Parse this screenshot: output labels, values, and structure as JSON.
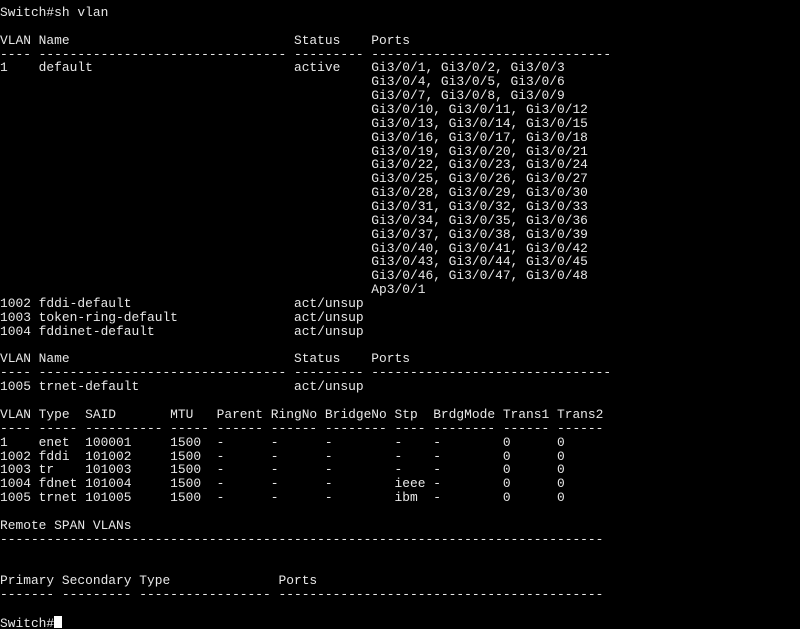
{
  "terminal": {
    "lines": [
      "Switch#sh vlan",
      "",
      "VLAN Name                             Status    Ports",
      "---- -------------------------------- --------- -------------------------------",
      "1    default                          active    Gi3/0/1, Gi3/0/2, Gi3/0/3",
      "                                                Gi3/0/4, Gi3/0/5, Gi3/0/6",
      "                                                Gi3/0/7, Gi3/0/8, Gi3/0/9",
      "                                                Gi3/0/10, Gi3/0/11, Gi3/0/12",
      "                                                Gi3/0/13, Gi3/0/14, Gi3/0/15",
      "                                                Gi3/0/16, Gi3/0/17, Gi3/0/18",
      "                                                Gi3/0/19, Gi3/0/20, Gi3/0/21",
      "                                                Gi3/0/22, Gi3/0/23, Gi3/0/24",
      "                                                Gi3/0/25, Gi3/0/26, Gi3/0/27",
      "                                                Gi3/0/28, Gi3/0/29, Gi3/0/30",
      "                                                Gi3/0/31, Gi3/0/32, Gi3/0/33",
      "                                                Gi3/0/34, Gi3/0/35, Gi3/0/36",
      "                                                Gi3/0/37, Gi3/0/38, Gi3/0/39",
      "                                                Gi3/0/40, Gi3/0/41, Gi3/0/42",
      "                                                Gi3/0/43, Gi3/0/44, Gi3/0/45",
      "                                                Gi3/0/46, Gi3/0/47, Gi3/0/48",
      "                                                Ap3/0/1",
      "1002 fddi-default                     act/unsup",
      "1003 token-ring-default               act/unsup",
      "1004 fddinet-default                  act/unsup",
      "",
      "VLAN Name                             Status    Ports",
      "---- -------------------------------- --------- -------------------------------",
      "1005 trnet-default                    act/unsup",
      "",
      "VLAN Type  SAID       MTU   Parent RingNo BridgeNo Stp  BrdgMode Trans1 Trans2",
      "---- ----- ---------- ----- ------ ------ -------- ---- -------- ------ ------",
      "1    enet  100001     1500  -      -      -        -    -        0      0",
      "1002 fddi  101002     1500  -      -      -        -    -        0      0",
      "1003 tr    101003     1500  -      -      -        -    -        0      0",
      "1004 fdnet 101004     1500  -      -      -        ieee -        0      0",
      "1005 trnet 101005     1500  -      -      -        ibm  -        0      0",
      "",
      "Remote SPAN VLANs",
      "------------------------------------------------------------------------------",
      "",
      "",
      "Primary Secondary Type              Ports",
      "------- --------- ----------------- ------------------------------------------",
      "",
      "Switch#"
    ]
  },
  "colors": {
    "background": "#000000",
    "foreground": "#e8e8e8",
    "cursor": "#ffffff"
  }
}
